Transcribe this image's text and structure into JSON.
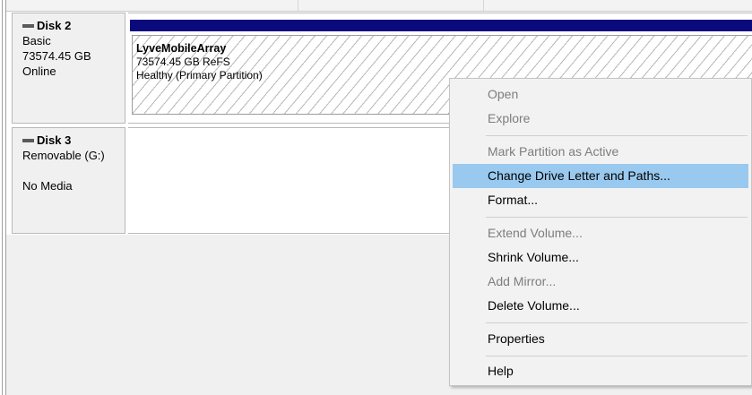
{
  "disks": [
    {
      "name": "Disk 2",
      "type": "Basic",
      "size": "73574.45 GB",
      "status": "Online",
      "partition": {
        "name": "LyveMobileArray",
        "fs": "73574.45 GB ReFS",
        "health": "Healthy (Primary Partition)"
      }
    },
    {
      "name": "Disk 3",
      "type": "Removable (G:)",
      "media": "No Media"
    }
  ],
  "context_menu": {
    "items": [
      {
        "label": "Open",
        "enabled": false
      },
      {
        "label": "Explore",
        "enabled": false
      },
      {
        "label": "Mark Partition as Active",
        "enabled": false
      },
      {
        "label": "Change Drive Letter and Paths...",
        "enabled": true,
        "highlighted": true
      },
      {
        "label": "Format...",
        "enabled": true
      },
      {
        "label": "Extend Volume...",
        "enabled": false
      },
      {
        "label": "Shrink Volume...",
        "enabled": true
      },
      {
        "label": "Add Mirror...",
        "enabled": false
      },
      {
        "label": "Delete Volume...",
        "enabled": true
      },
      {
        "label": "Properties",
        "enabled": true
      },
      {
        "label": "Help",
        "enabled": true
      }
    ]
  },
  "colors": {
    "volume_bar": "#0a0a7d",
    "menu_highlight": "#99c9ef",
    "disabled_text": "#7d7d7d"
  }
}
